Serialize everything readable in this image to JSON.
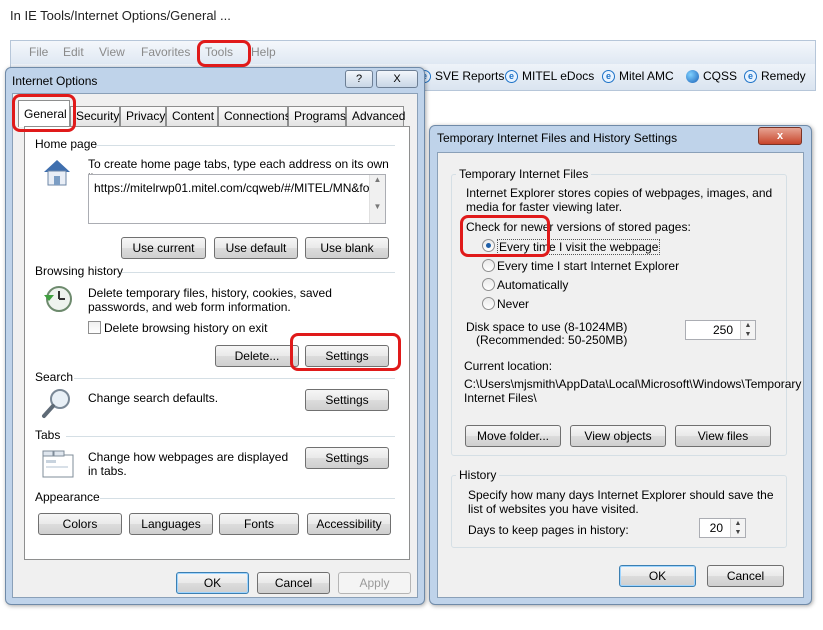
{
  "caption": "In IE Tools/Internet Options/General ...",
  "menubar": {
    "items": [
      "File",
      "Edit",
      "View",
      "Favorites",
      "Tools",
      "Help"
    ]
  },
  "favorites": [
    "SVE Reports",
    "MITEL eDocs",
    "Mitel AMC",
    "CQSS",
    "Remedy"
  ],
  "internet_options": {
    "title": "Internet Options",
    "tabs": [
      "General",
      "Security",
      "Privacy",
      "Content",
      "Connections",
      "Programs",
      "Advanced"
    ],
    "home_page": {
      "label": "Home page",
      "desc": "To create home page tabs, type each address on its own line.",
      "url": "https://mitelrwp01.mitel.com/cqweb/#/MITEL/MN&fo",
      "buttons": [
        "Use current",
        "Use default",
        "Use blank"
      ]
    },
    "browsing_history": {
      "label": "Browsing history",
      "desc": "Delete temporary files, history, cookies, saved passwords, and web form information.",
      "checkbox_label": "Delete browsing history on exit",
      "checkbox_checked": false,
      "delete_btn": "Delete...",
      "settings_btn": "Settings"
    },
    "search": {
      "label": "Search",
      "desc": "Change search defaults.",
      "settings_btn": "Settings"
    },
    "tabs_section": {
      "label": "Tabs",
      "desc": "Change how webpages are displayed in tabs.",
      "settings_btn": "Settings"
    },
    "appearance": {
      "label": "Appearance",
      "buttons": [
        "Colors",
        "Languages",
        "Fonts",
        "Accessibility"
      ]
    },
    "footer": {
      "ok": "OK",
      "cancel": "Cancel",
      "apply": "Apply"
    },
    "help_glyph": "?",
    "close_glyph": "X"
  },
  "temp_settings": {
    "title": "Temporary Internet Files and History Settings",
    "close_glyph": "x",
    "temp_files": {
      "label": "Temporary Internet Files",
      "desc": "Internet Explorer stores copies of webpages, images, and media for faster viewing later.",
      "check_label": "Check for newer versions of stored pages:",
      "options": [
        "Every time I visit the webpage",
        "Every time I start Internet Explorer",
        "Automatically",
        "Never"
      ],
      "selected_index": 0,
      "disk_label": "Disk space to use (8-1024MB)",
      "disk_recommended": "(Recommended: 50-250MB)",
      "disk_value": "250",
      "location_label": "Current location:",
      "location_path": "C:\\Users\\mjsmith\\AppData\\Local\\Microsoft\\Windows\\Temporary Internet Files\\",
      "buttons": [
        "Move folder...",
        "View objects",
        "View files"
      ]
    },
    "history": {
      "label": "History",
      "desc": "Specify how many days Internet Explorer should save the list of websites you have visited.",
      "days_label": "Days to keep pages in history:",
      "days_value": "20"
    },
    "footer": {
      "ok": "OK",
      "cancel": "Cancel"
    }
  },
  "colors": {
    "highlight": "#e01a1a",
    "frame": "#bfd3ea"
  }
}
